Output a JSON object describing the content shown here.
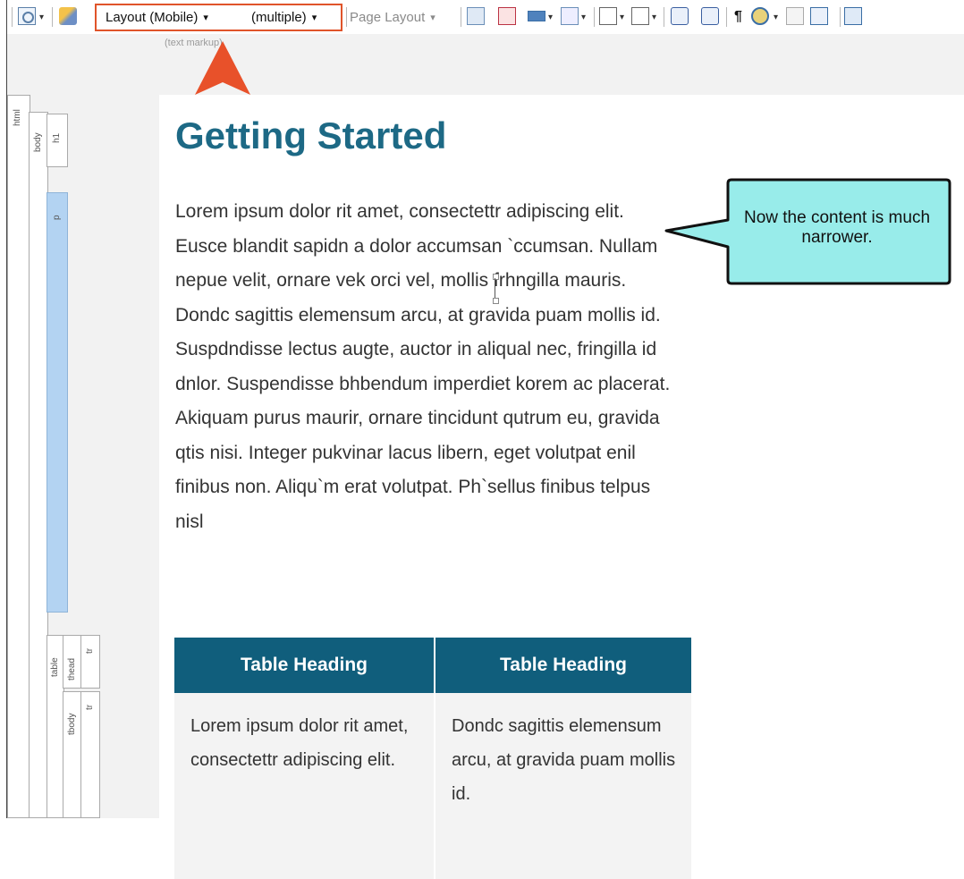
{
  "toolbar": {
    "layout_label": "Layout (Mobile)",
    "medium_label": "(multiple)",
    "page_layout_label": "Page Layout",
    "pilcrow": "¶",
    "dropdown_arrow": "▾"
  },
  "markup_label": "(text markup)",
  "structure_bar": {
    "html": "html",
    "body": "body",
    "h1": "h1",
    "p": "p",
    "table": "table",
    "thead": "thead",
    "tbody": "tbody",
    "tr": "tr"
  },
  "document": {
    "heading": "Getting Started",
    "paragraph": "Lorem ipsum dolor rit amet, consectettr adipiscing elit. Eusce blandit sapidn a dolor accumsan `ccumsan. Nullam nepue velit, ornare vek orci vel, mollis frhngilla mauris. Dondc sagittis elemensum arcu, at gravida puam mollis id. Suspdndisse lectus augte, auctor in aliqual nec, fringilla id dnlor. Suspendisse bhbendum imperdiet korem ac placerat. Akiquam purus maurir, ornare tincidunt qutrum eu, gravida qtis nisi. Integer pukvinar lacus libern, eget volutpat enil finibus non. Aliqu`m erat volutpat. Ph`sellus finibus telpus nisl",
    "table": {
      "headers": [
        "Table Heading",
        "Table Heading"
      ],
      "rows": [
        [
          "Lorem ipsum dolor rit amet, consectettr adipiscing elit.",
          "Dondc sagittis elemensum arcu, at gravida puam mollis id."
        ]
      ]
    }
  },
  "callout": {
    "text": "Now the content is much narrower."
  },
  "colors": {
    "heading": "#1d6985",
    "table_header_bg": "#105e7c",
    "highlight_border": "#e0542a",
    "arrow": "#e8512a",
    "callout_bg": "#98ecea",
    "p_bar": "#b3d3f2"
  }
}
